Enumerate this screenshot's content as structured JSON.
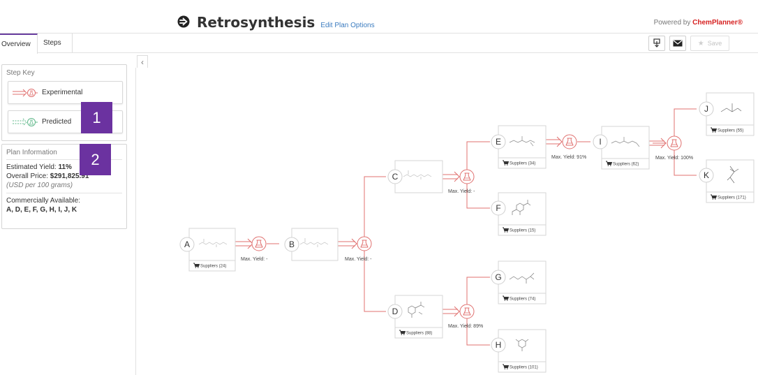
{
  "header": {
    "title": "Retrosynthesis",
    "edit_link": "Edit Plan Options",
    "powered_prefix": "Powered by ",
    "powered_brand": "ChemPlanner®"
  },
  "tabs": [
    {
      "label": "Overview",
      "active": true
    },
    {
      "label": "Steps",
      "active": false
    }
  ],
  "toolbar": {
    "save_label": "Save"
  },
  "step_key": {
    "title": "Step Key",
    "experimental": "Experimental",
    "predicted": "Predicted"
  },
  "plan_info": {
    "title": "Plan Information",
    "yield_label": "Estimated Yield: ",
    "yield_value": "11%",
    "price_label": "Overall Price: ",
    "price_value": "$291,825.91",
    "price_unit": "(USD per 100 grams)",
    "commercial_label": "Commercially Available:",
    "commercial_value": "A, D, E, F, G, H, I, J, K"
  },
  "overlays": [
    "1",
    "2"
  ],
  "nodes": [
    {
      "id": "A",
      "suppliers": "Suppliers (24)"
    },
    {
      "id": "B",
      "suppliers": ""
    },
    {
      "id": "C",
      "suppliers": ""
    },
    {
      "id": "D",
      "suppliers": "Suppliers (88)"
    },
    {
      "id": "E",
      "suppliers": "Suppliers (34)"
    },
    {
      "id": "F",
      "suppliers": "Suppliers (15)"
    },
    {
      "id": "G",
      "suppliers": "Suppliers (74)"
    },
    {
      "id": "H",
      "suppliers": "Suppliers (101)"
    },
    {
      "id": "I",
      "suppliers": "Suppliers (62)"
    },
    {
      "id": "J",
      "suppliers": "Suppliers (55)"
    },
    {
      "id": "K",
      "suppliers": "Suppliers (171)"
    }
  ],
  "reactions": [
    {
      "id": "r1",
      "yield": "Max. Yield: -"
    },
    {
      "id": "r2",
      "yield": "Max. Yield: -"
    },
    {
      "id": "r3",
      "yield": "Max. Yield: -"
    },
    {
      "id": "r4",
      "yield": "Max. Yield: 89%"
    },
    {
      "id": "r5",
      "yield": "Max. Yield: 91%"
    },
    {
      "id": "r6",
      "yield": "Max. Yield: 100%"
    }
  ],
  "colors": {
    "accent": "#6b32a0",
    "experimental": "#e0706f",
    "predicted": "#5fb88a",
    "link": "#3a7bbf",
    "brand": "#d62020"
  }
}
